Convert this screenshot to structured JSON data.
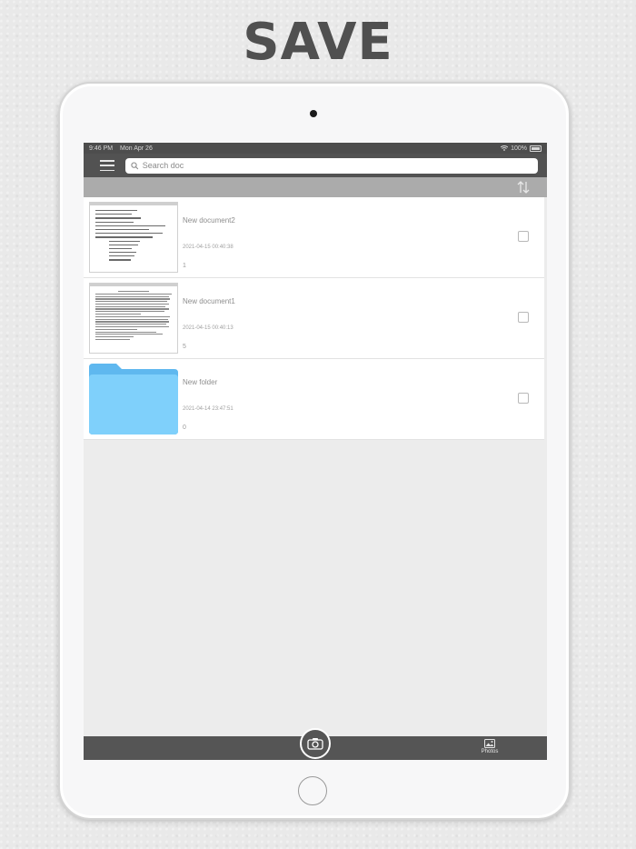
{
  "headline": "SAVE",
  "status": {
    "time": "9:46 PM",
    "date": "Mon Apr 26",
    "battery": "100%"
  },
  "search": {
    "placeholder": "Search doc"
  },
  "documents": [
    {
      "title": "New document2",
      "date": "2021-04-15 00:40:38",
      "count": "1",
      "kind": "document"
    },
    {
      "title": "New document1",
      "date": "2021-04-15 00:40:13",
      "count": "5",
      "kind": "document"
    },
    {
      "title": "New folder",
      "date": "2021-04-14 23:47:51",
      "count": "0",
      "kind": "folder"
    }
  ],
  "bottom": {
    "photos_label": "Photos"
  },
  "colors": {
    "bar": "#525252",
    "sortbar": "#ababab",
    "folder": "#6ec7f7"
  },
  "icons": [
    "menu-icon",
    "search-icon",
    "sort-icon",
    "camera-icon",
    "photos-icon",
    "wifi-icon",
    "battery-icon"
  ]
}
